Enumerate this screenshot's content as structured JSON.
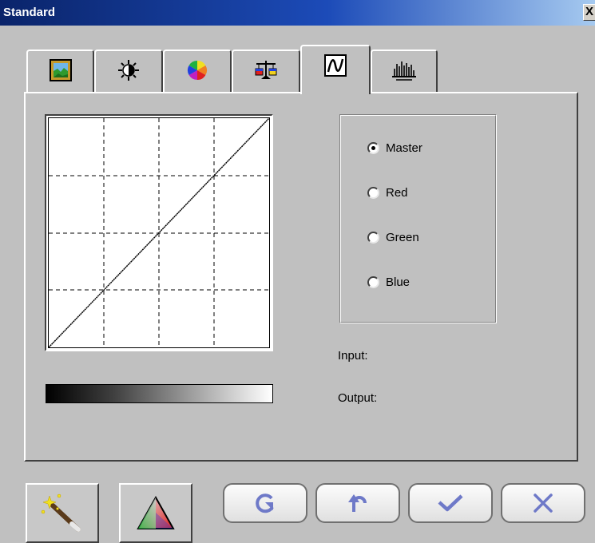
{
  "window": {
    "title": "Standard",
    "close_label": "X"
  },
  "tabs": [
    {
      "icon": "picture-icon",
      "active": false
    },
    {
      "icon": "brightness-icon",
      "active": false
    },
    {
      "icon": "color-wheel-icon",
      "active": false
    },
    {
      "icon": "balance-icon",
      "active": false
    },
    {
      "icon": "curve-icon",
      "active": true
    },
    {
      "icon": "histogram-icon",
      "active": false
    }
  ],
  "curve": {
    "points": [
      [
        0,
        0
      ],
      [
        255,
        255
      ]
    ],
    "grid": true
  },
  "channels": {
    "selected": "Master",
    "options": [
      "Master",
      "Red",
      "Green",
      "Blue"
    ]
  },
  "info": {
    "input_label": "Input:",
    "output_label": "Output:"
  },
  "buttons": [
    {
      "icon": "magic-wand-icon"
    },
    {
      "icon": "rgb-triangle-icon"
    },
    {
      "icon": "refresh-icon"
    },
    {
      "icon": "undo-icon"
    },
    {
      "icon": "checkmark-icon"
    },
    {
      "icon": "cancel-x-icon"
    }
  ],
  "colors": {
    "titlebar": "#0a246a",
    "button_icon_blue": "#6e79c8",
    "background": "#c0c0c0"
  }
}
